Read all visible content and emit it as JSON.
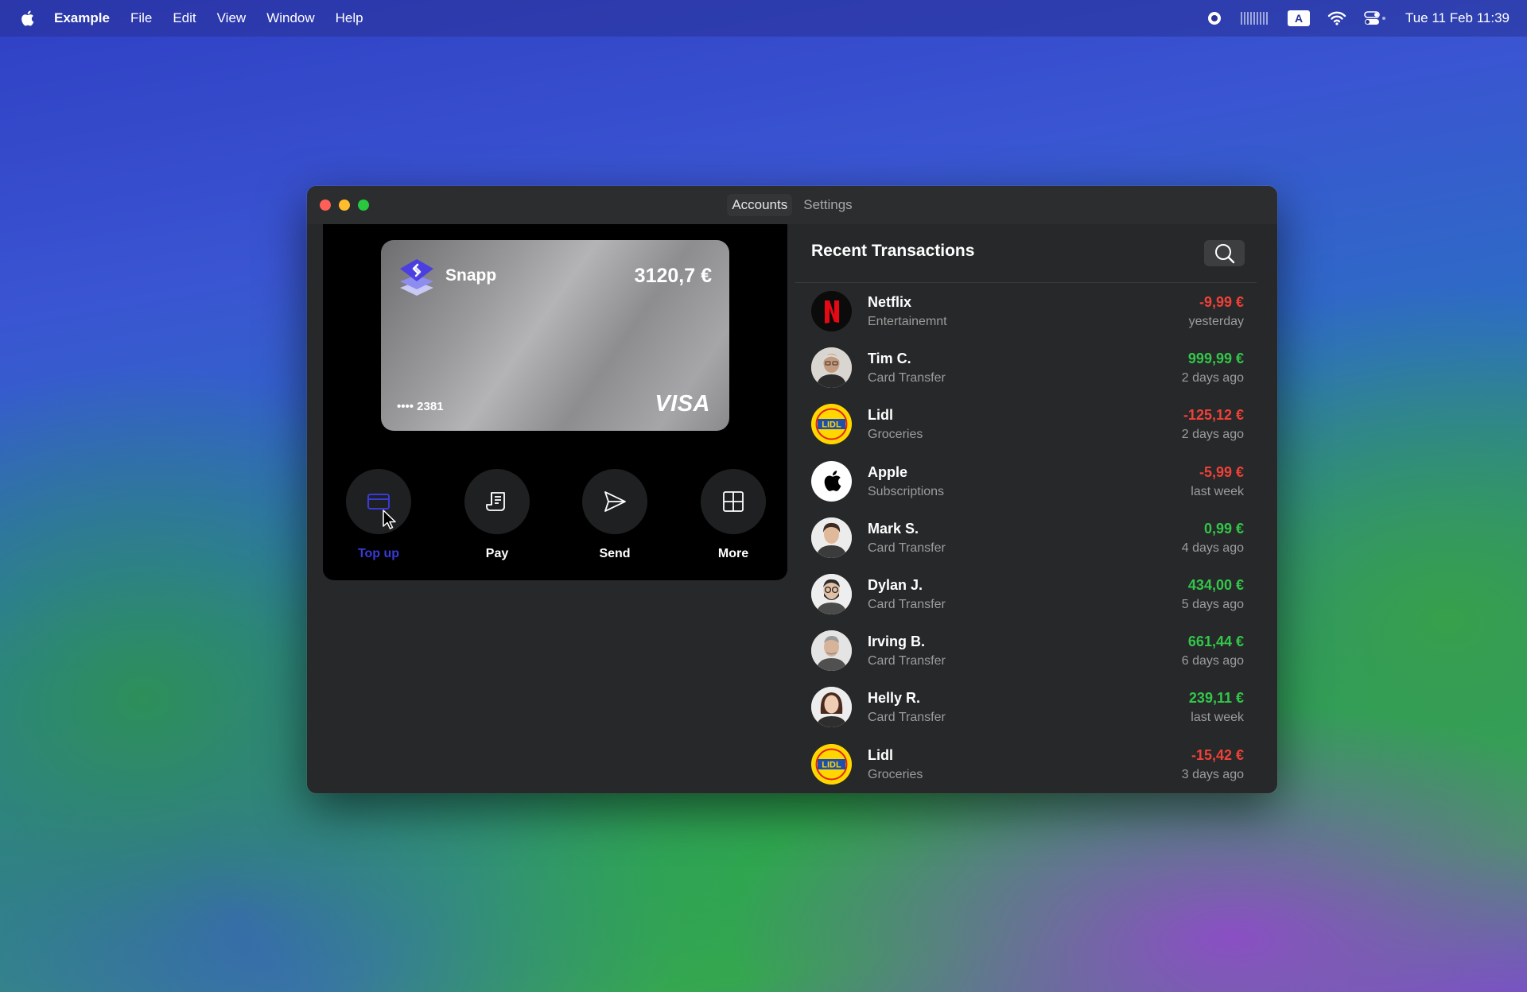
{
  "menubar": {
    "app_name": "Example",
    "menus": [
      "File",
      "Edit",
      "View",
      "Window",
      "Help"
    ],
    "clock": "Tue 11 Feb  11:39"
  },
  "window": {
    "tabs": [
      {
        "label": "Accounts",
        "active": true
      },
      {
        "label": "Settings",
        "active": false
      }
    ]
  },
  "card": {
    "brand": "Snapp",
    "balance": "3120,7 €",
    "masked_number": "•••• 2381",
    "network": "VISA"
  },
  "actions": [
    {
      "label": "Top up",
      "icon": "card-icon",
      "active": true
    },
    {
      "label": "Pay",
      "icon": "receipt-icon",
      "active": false
    },
    {
      "label": "Send",
      "icon": "send-icon",
      "active": false
    },
    {
      "label": "More",
      "icon": "grid-icon",
      "active": false
    }
  ],
  "transactions": {
    "title": "Recent Transactions",
    "items": [
      {
        "name": "Netflix",
        "category": "Entertainemnt",
        "amount": "-9,99 €",
        "when": "yesterday",
        "type": "negative",
        "avatar": "netflix-logo"
      },
      {
        "name": "Tim C.",
        "category": "Card Transfer",
        "amount": "999,99 €",
        "when": "2 days ago",
        "type": "positive",
        "avatar": "person-avatar"
      },
      {
        "name": "Lidl",
        "category": "Groceries",
        "amount": "-125,12 €",
        "when": "2 days ago",
        "type": "negative",
        "avatar": "lidl-logo"
      },
      {
        "name": "Apple",
        "category": "Subscriptions",
        "amount": "-5,99 €",
        "when": "last week",
        "type": "negative",
        "avatar": "apple-logo"
      },
      {
        "name": "Mark S.",
        "category": "Card Transfer",
        "amount": "0,99 €",
        "when": "4 days ago",
        "type": "positive",
        "avatar": "person-avatar"
      },
      {
        "name": "Dylan J.",
        "category": "Card Transfer",
        "amount": "434,00 €",
        "when": "5 days ago",
        "type": "positive",
        "avatar": "person-avatar"
      },
      {
        "name": "Irving B.",
        "category": "Card Transfer",
        "amount": "661,44 €",
        "when": "6 days ago",
        "type": "positive",
        "avatar": "person-avatar"
      },
      {
        "name": "Helly R.",
        "category": "Card Transfer",
        "amount": "239,11 €",
        "when": "last week",
        "type": "positive",
        "avatar": "person-avatar"
      },
      {
        "name": "Lidl",
        "category": "Groceries",
        "amount": "-15,42 €",
        "when": "3 days ago",
        "type": "negative",
        "avatar": "lidl-logo"
      }
    ]
  },
  "colors": {
    "accent": "#3a3ad9",
    "negative": "#ef4138",
    "positive": "#34c64a"
  }
}
